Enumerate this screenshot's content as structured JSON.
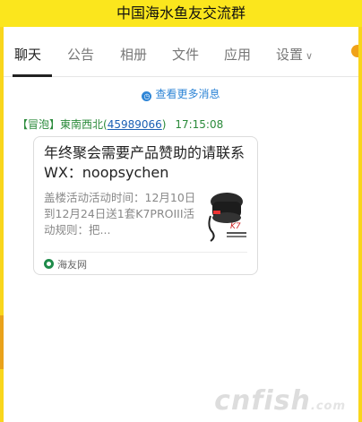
{
  "window": {
    "title": "中国海水鱼友交流群"
  },
  "tabs": [
    {
      "label": "聊天",
      "active": true
    },
    {
      "label": "公告"
    },
    {
      "label": "相册"
    },
    {
      "label": "文件"
    },
    {
      "label": "应用"
    },
    {
      "label": "设置"
    }
  ],
  "history": {
    "label": "查看更多消息"
  },
  "message": {
    "badge": "【冒泡】",
    "sender": "東南西北",
    "qq_open": "(",
    "qq": "45989066",
    "qq_close": ")",
    "time": "17:15:08",
    "card": {
      "title": "年终聚会需要产品赞助的请联系WX：noopsychen",
      "description": "盖楼活动活动时间：12月10日到12月24日送1套K7PROIII活动规则：把...",
      "source": "海友网"
    }
  },
  "watermark": {
    "main": "cnfish",
    "suffix": ".com"
  },
  "colors": {
    "title_bar": "#fbe61d",
    "link": "#2e85d6",
    "sender": "#2a8a3a"
  }
}
